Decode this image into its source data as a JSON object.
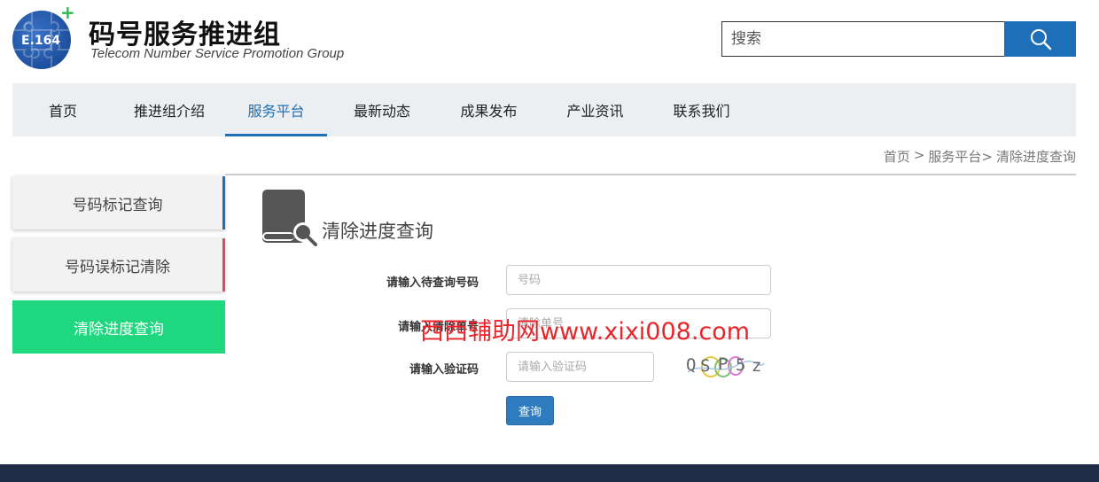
{
  "header": {
    "logo_badge": "E.164",
    "logo_plus": "+",
    "brand_cn": "码号服务推进组",
    "brand_en": "Telecom Number Service  Promotion Group",
    "search_placeholder": "搜索",
    "search_icon": "search-icon"
  },
  "nav": {
    "items": [
      {
        "label": "首页"
      },
      {
        "label": "推进组介绍"
      },
      {
        "label": "服务平台"
      },
      {
        "label": "最新动态"
      },
      {
        "label": "成果发布"
      },
      {
        "label": "产业资讯"
      },
      {
        "label": "联系我们"
      }
    ],
    "active_index": 2
  },
  "breadcrumb": {
    "home": "首页",
    "sep1": ">",
    "platform": "服务平台>",
    "current": "清除进度查询"
  },
  "sidebar": {
    "items": [
      {
        "label": "号码标记查询"
      },
      {
        "label": "号码误标记清除"
      },
      {
        "label": "清除进度查询"
      }
    ]
  },
  "main": {
    "icon": "book-search-icon",
    "title": "清除进度查询",
    "form": {
      "number_label": "请输入待查询号码",
      "number_placeholder": "号码",
      "clear_label": "请输入清除单号",
      "clear_placeholder": "清除单号",
      "captcha_label": "请输入验证码",
      "captcha_placeholder": "请输入验证码",
      "captcha_chars": [
        "Q",
        "S",
        "P",
        "5",
        "z"
      ],
      "submit_label": "查询"
    }
  },
  "watermark": "西西辅助网www.xixi008.com",
  "colors": {
    "primary": "#1d6fb8",
    "active_sidebar": "#1fd77f",
    "sidebar_red": "#e04b5c",
    "footer": "#1f2d47",
    "watermark": "#e8252a"
  }
}
